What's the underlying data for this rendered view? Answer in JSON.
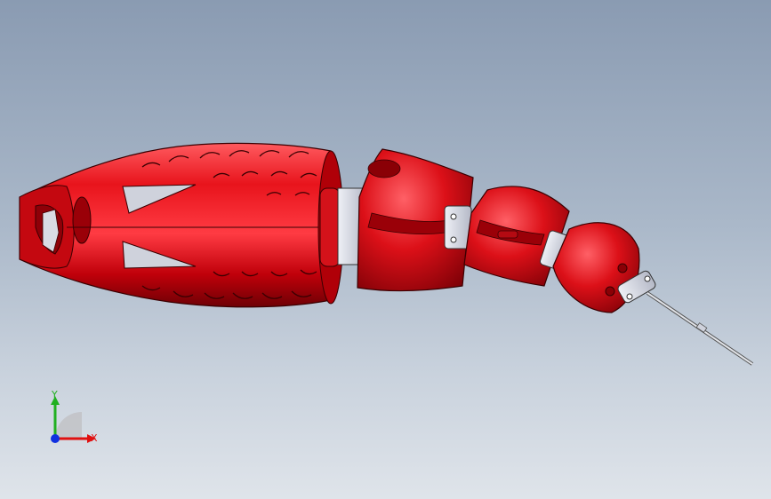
{
  "viewport": {
    "background_top": "#8a9bb2",
    "background_bottom": "#dfe4ea"
  },
  "model": {
    "description_icon": "robotic-fish-model-icon",
    "body_color": "#e0141c",
    "body_shade_color": "#7a0006",
    "bracket_color": "#c9ccd8",
    "rod_color": "#d9dbe0"
  },
  "triad": {
    "x_label": "X",
    "y_label": "Y",
    "x_color": "#e01010",
    "y_color": "#20b020",
    "z_color": "#1030e0"
  }
}
